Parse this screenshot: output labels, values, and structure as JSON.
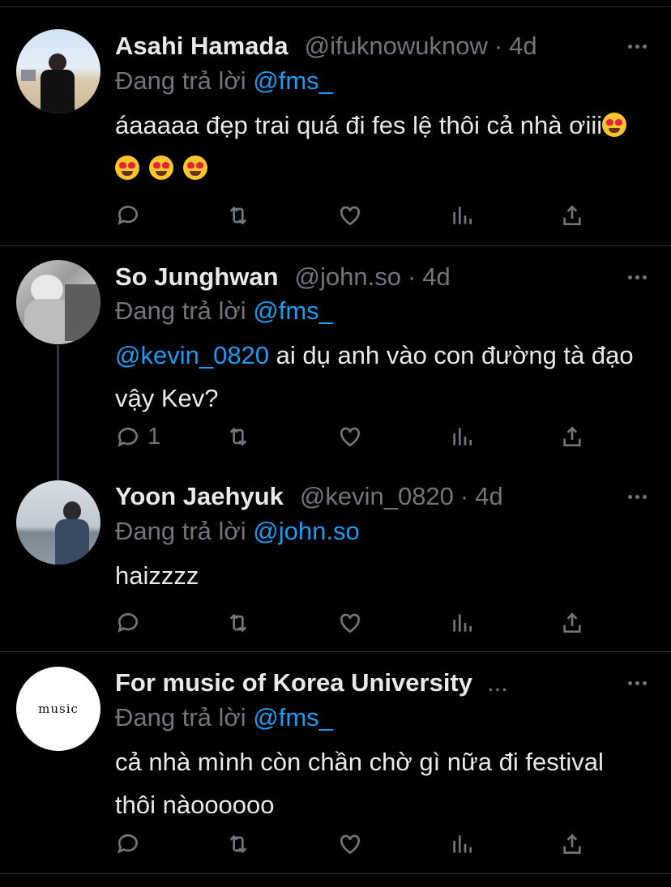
{
  "replying_label": "Đang trả lời",
  "tweets": [
    {
      "name": "Asahi Hamada",
      "handle": "@ifuknowuknow",
      "time": "4d",
      "reply_to": "@fms_",
      "text": "áaaaaa đẹp trai quá đi fes lệ thôi cả nhà ơiii",
      "emoji_count": 4,
      "reply_count": ""
    },
    {
      "name": "So Junghwan",
      "handle": "@john.so",
      "time": "4d",
      "reply_to": "@fms_",
      "mention": "@kevin_0820",
      "text": " ai dụ anh vào con đường tà đạo vậy Kev?",
      "reply_count": "1"
    },
    {
      "name": "Yoon Jaehyuk",
      "handle": "@kevin_0820",
      "time": "4d",
      "reply_to": "@john.so",
      "text": "haizzzz",
      "reply_count": ""
    },
    {
      "name": "For music of Korea University",
      "handle": "...",
      "reply_to": "@fms_",
      "avatar_text": "music",
      "text": "cả nhà mình còn chần chờ gì nữa đi festival thôi nàoooooo",
      "reply_count": ""
    }
  ],
  "icons": [
    "reply-icon",
    "retweet-icon",
    "like-icon",
    "analytics-icon",
    "share-icon",
    "more-icon"
  ],
  "colors": {
    "background": "#000000",
    "text": "#e7e9ea",
    "muted": "#71767b",
    "link": "#1d9bf0",
    "divider": "#2f3336"
  }
}
